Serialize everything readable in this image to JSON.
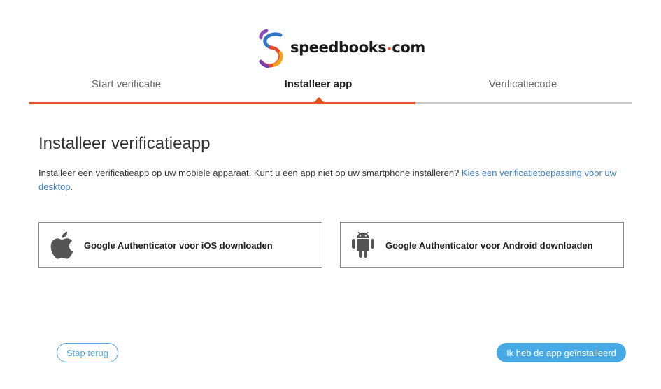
{
  "brand": {
    "name": "speedbooks",
    "dot": "•",
    "tld": "com"
  },
  "steps": [
    {
      "label": "Start verificatie",
      "state": "done"
    },
    {
      "label": "Installeer app",
      "state": "active"
    },
    {
      "label": "Verificatiecode",
      "state": "pending"
    }
  ],
  "progress": {
    "completed_fraction": 0.64
  },
  "main": {
    "title": "Installeer verificatieapp",
    "description": "Installeer een verificatieapp op uw mobiele apparaat. Kunt u een app niet op uw smartphone installeren?",
    "desktop_link": "Kies een verificatietoepassing voor uw desktop",
    "period": "."
  },
  "downloads": [
    {
      "label": "Google Authenticator voor iOS downloaden",
      "icon": "apple-icon"
    },
    {
      "label": "Google Authenticator voor Android downloaden",
      "icon": "android-icon"
    }
  ],
  "actions": {
    "back": "Stap terug",
    "next": "Ik heb de app geïnstalleerd"
  },
  "colors": {
    "accent": "#e04e1b",
    "primary": "#47a9e3",
    "link": "#3e7ec3",
    "track": "#c8c8c8"
  }
}
